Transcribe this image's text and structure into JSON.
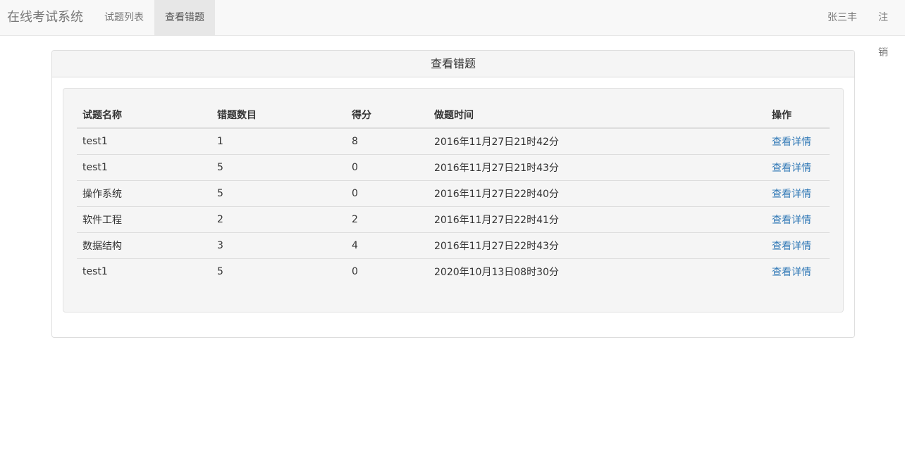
{
  "navbar": {
    "brand": "在线考试系统",
    "items": [
      {
        "label": "试题列表",
        "active": false
      },
      {
        "label": "查看错题",
        "active": true
      }
    ],
    "user": "张三丰",
    "logout": "注销"
  },
  "panel": {
    "title": "查看错题"
  },
  "table": {
    "headers": [
      "试题名称",
      "错题数目",
      "得分",
      "做题时间",
      "操作"
    ],
    "rows": [
      {
        "name": "test1",
        "wrong_count": "1",
        "score": "8",
        "time": "2016年11月27日21时42分",
        "action": "查看详情"
      },
      {
        "name": "test1",
        "wrong_count": "5",
        "score": "0",
        "time": "2016年11月27日21时43分",
        "action": "查看详情"
      },
      {
        "name": "操作系统",
        "wrong_count": "5",
        "score": "0",
        "time": "2016年11月27日22时40分",
        "action": "查看详情"
      },
      {
        "name": "软件工程",
        "wrong_count": "2",
        "score": "2",
        "time": "2016年11月27日22时41分",
        "action": "查看详情"
      },
      {
        "name": "数据结构",
        "wrong_count": "3",
        "score": "4",
        "time": "2016年11月27日22时43分",
        "action": "查看详情"
      },
      {
        "name": "test1",
        "wrong_count": "5",
        "score": "0",
        "time": "2020年10月13日08时30分",
        "action": "查看详情"
      }
    ]
  },
  "colors": {
    "link": "#337ab7",
    "navbar_bg": "#f8f8f8",
    "active_nav_bg": "#e7e7e7"
  }
}
